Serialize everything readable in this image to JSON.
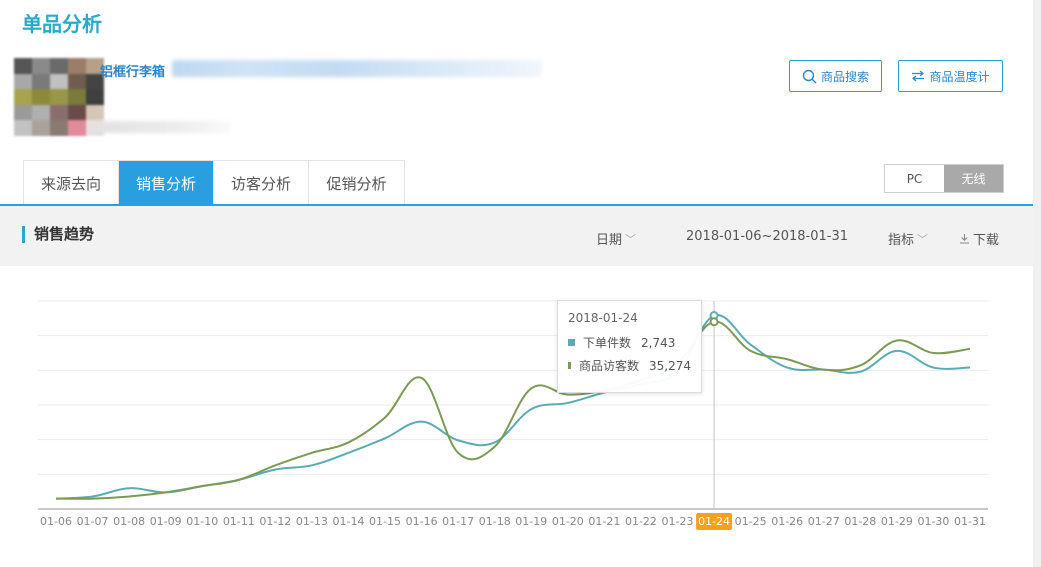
{
  "page": {
    "title": "单品分析"
  },
  "product": {
    "name": "铝框行李箱"
  },
  "actions": {
    "search_label": "商品搜索",
    "temp_label": "商品温度计"
  },
  "tabs": [
    {
      "label": "来源去向",
      "active": false
    },
    {
      "label": "销售分析",
      "active": true
    },
    {
      "label": "访客分析",
      "active": false
    },
    {
      "label": "促销分析",
      "active": false
    }
  ],
  "device": {
    "pc": "PC",
    "wireless": "无线",
    "selected": "无线"
  },
  "section": {
    "title": "销售趋势",
    "date_label": "日期",
    "date_range": "2018-01-06~2018-01-31",
    "metric_label": "指标",
    "download_label": "下载"
  },
  "colors": {
    "accent": "#2a9fe0",
    "series_orders": "#5aacb2",
    "series_visitors": "#7d9a55",
    "highlight": "#f5a11b"
  },
  "chart_data": {
    "type": "line",
    "categories": [
      "01-06",
      "01-07",
      "01-08",
      "01-09",
      "01-10",
      "01-11",
      "01-12",
      "01-13",
      "01-14",
      "01-15",
      "01-16",
      "01-17",
      "01-18",
      "01-19",
      "01-20",
      "01-21",
      "01-22",
      "01-23",
      "01-24",
      "01-25",
      "01-26",
      "01-27",
      "01-28",
      "01-29",
      "01-30",
      "01-31"
    ],
    "series": [
      {
        "name": "下单件数",
        "color": "#5aacb2",
        "values": [
          0.05,
          0.06,
          0.1,
          0.08,
          0.11,
          0.14,
          0.19,
          0.21,
          0.27,
          0.34,
          0.42,
          0.33,
          0.32,
          0.48,
          0.51,
          0.56,
          0.6,
          0.66,
          0.93,
          0.79,
          0.68,
          0.67,
          0.66,
          0.76,
          0.68,
          0.68
        ]
      },
      {
        "name": "商品访客数",
        "color": "#7d9a55",
        "values": [
          0.05,
          0.05,
          0.06,
          0.08,
          0.11,
          0.14,
          0.21,
          0.27,
          0.32,
          0.44,
          0.63,
          0.27,
          0.3,
          0.58,
          0.55,
          0.57,
          0.62,
          0.7,
          0.9,
          0.76,
          0.72,
          0.67,
          0.69,
          0.81,
          0.75,
          0.77
        ]
      }
    ],
    "ylim": [
      0,
      1
    ],
    "grid": true,
    "highlight_index": 18,
    "tooltip": {
      "date": "2018-01-24",
      "rows": [
        {
          "name": "下单件数",
          "value": "2,743"
        },
        {
          "name": "商品访客数",
          "value": "35,274"
        }
      ]
    }
  }
}
